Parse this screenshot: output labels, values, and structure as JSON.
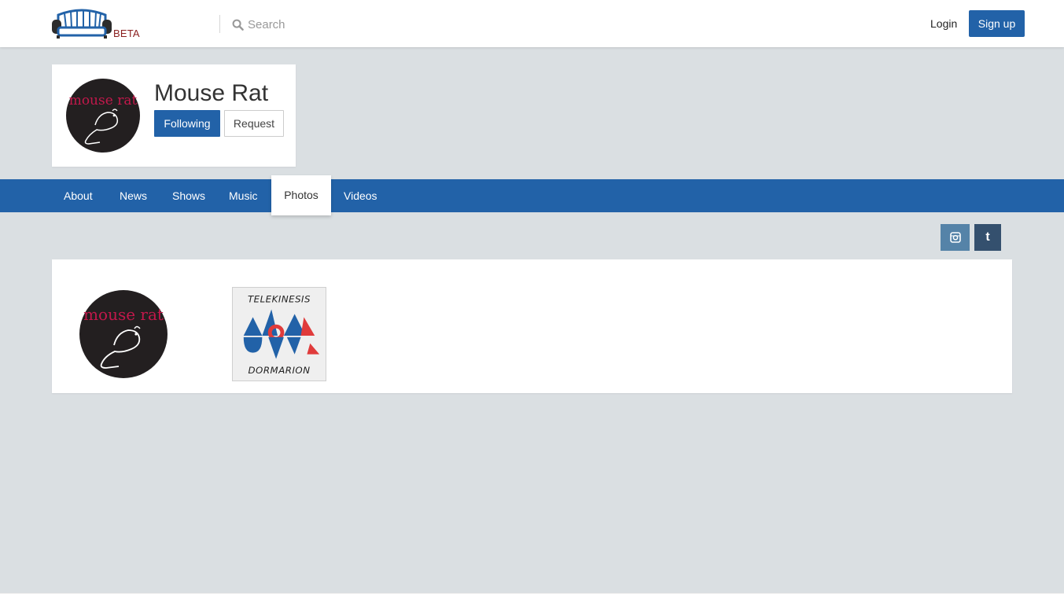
{
  "header": {
    "logo_badge": "BETA",
    "search_placeholder": "Search",
    "login_label": "Login",
    "signup_label": "Sign up",
    "accent_color": "#2262a8"
  },
  "profile": {
    "name": "Mouse Rat",
    "avatar_text": "mouse rat",
    "following_label": "Following",
    "request_label": "Request"
  },
  "tabs": [
    {
      "label": "About",
      "active": false
    },
    {
      "label": "News",
      "active": false
    },
    {
      "label": "Shows",
      "active": false
    },
    {
      "label": "Music",
      "active": false
    },
    {
      "label": "Photos",
      "active": true
    },
    {
      "label": "Videos",
      "active": false
    }
  ],
  "social": [
    {
      "icon": "instagram-icon"
    },
    {
      "icon": "tumblr-icon",
      "glyph": "t"
    }
  ],
  "photos": [
    {
      "text": "mouse rat"
    },
    {
      "top_text": "TELEKINESIS",
      "bottom_text": "DORMARION"
    }
  ]
}
